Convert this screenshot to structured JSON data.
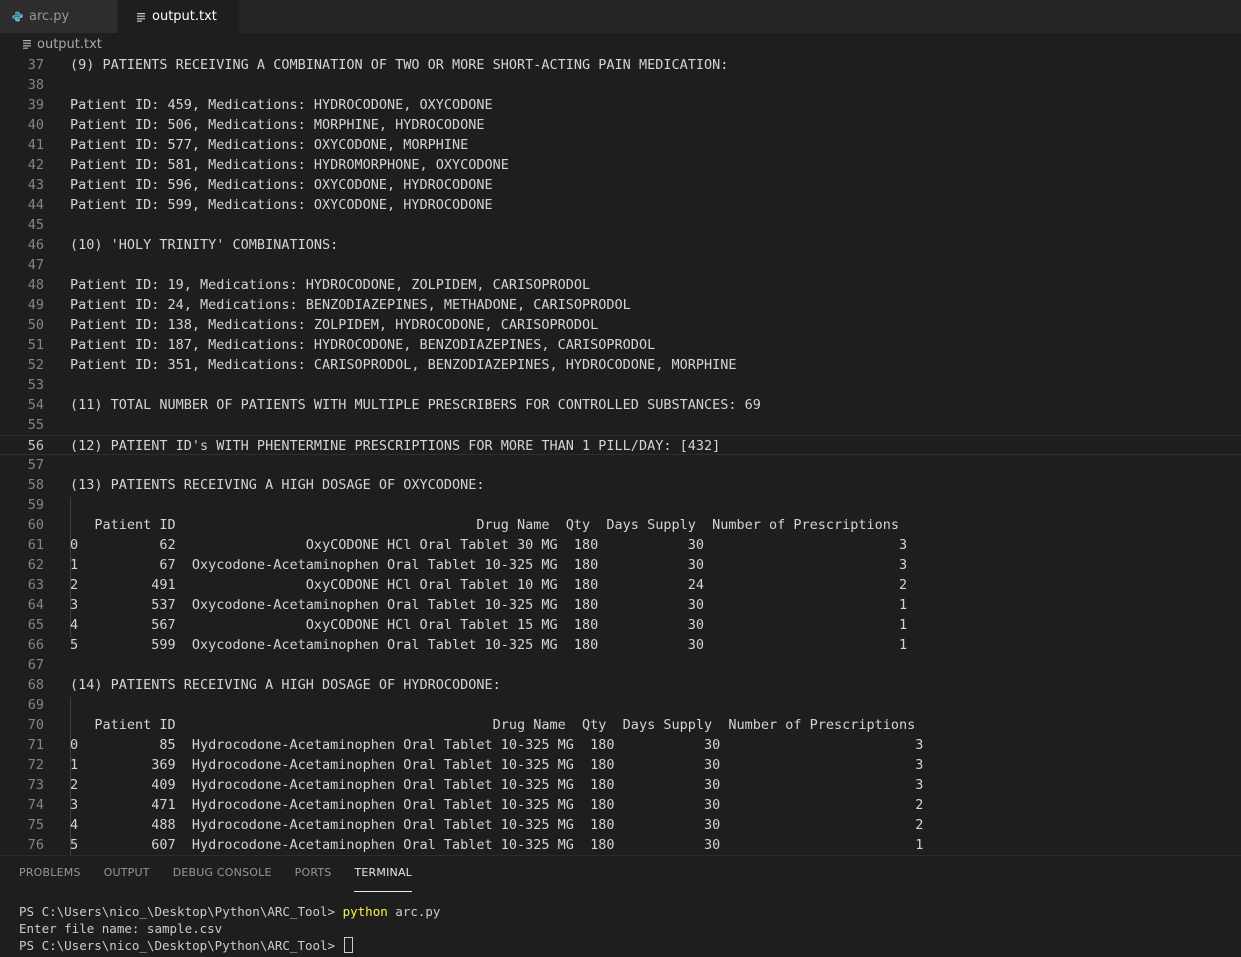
{
  "tabs": [
    {
      "label": "arc.py",
      "icon": "python-icon"
    },
    {
      "label": "output.txt",
      "icon": "text-file-icon"
    }
  ],
  "breadcrumb": {
    "label": "output.txt",
    "icon": "text-file-icon"
  },
  "editor": {
    "current_line": 56,
    "lines": [
      {
        "n": "37",
        "text": "(9) PATIENTS RECEIVING A COMBINATION OF TWO OR MORE SHORT-ACTING PAIN MEDICATION:"
      },
      {
        "n": "38",
        "text": ""
      },
      {
        "n": "39",
        "text": "Patient ID: 459, Medications: HYDROCODONE, OXYCODONE"
      },
      {
        "n": "40",
        "text": "Patient ID: 506, Medications: MORPHINE, HYDROCODONE"
      },
      {
        "n": "41",
        "text": "Patient ID: 577, Medications: OXYCODONE, MORPHINE"
      },
      {
        "n": "42",
        "text": "Patient ID: 581, Medications: HYDROMORPHONE, OXYCODONE"
      },
      {
        "n": "43",
        "text": "Patient ID: 596, Medications: OXYCODONE, HYDROCODONE"
      },
      {
        "n": "44",
        "text": "Patient ID: 599, Medications: OXYCODONE, HYDROCODONE"
      },
      {
        "n": "45",
        "text": ""
      },
      {
        "n": "46",
        "text": "(10) 'HOLY TRINITY' COMBINATIONS:"
      },
      {
        "n": "47",
        "text": ""
      },
      {
        "n": "48",
        "text": "Patient ID: 19, Medications: HYDROCODONE, ZOLPIDEM, CARISOPRODOL"
      },
      {
        "n": "49",
        "text": "Patient ID: 24, Medications: BENZODIAZEPINES, METHADONE, CARISOPRODOL"
      },
      {
        "n": "50",
        "text": "Patient ID: 138, Medications: ZOLPIDEM, HYDROCODONE, CARISOPRODOL"
      },
      {
        "n": "51",
        "text": "Patient ID: 187, Medications: HYDROCODONE, BENZODIAZEPINES, CARISOPRODOL"
      },
      {
        "n": "52",
        "text": "Patient ID: 351, Medications: CARISOPRODOL, BENZODIAZEPINES, HYDROCODONE, MORPHINE"
      },
      {
        "n": "53",
        "text": ""
      },
      {
        "n": "54",
        "text": "(11) TOTAL NUMBER OF PATIENTS WITH MULTIPLE PRESCRIBERS FOR CONTROLLED SUBSTANCES: 69"
      },
      {
        "n": "55",
        "text": ""
      },
      {
        "n": "56",
        "text": "(12) PATIENT ID's WITH PHENTERMINE PRESCRIPTIONS FOR MORE THAN 1 PILL/DAY: [432]"
      },
      {
        "n": "57",
        "text": ""
      },
      {
        "n": "58",
        "text": "(13) PATIENTS RECEIVING A HIGH DOSAGE OF OXYCODONE:"
      },
      {
        "n": "59",
        "text": ""
      },
      {
        "n": "60",
        "text": "   Patient ID                                     Drug Name  Qty  Days Supply  Number of Prescriptions"
      },
      {
        "n": "61",
        "text": "0          62                OxyCODONE HCl Oral Tablet 30 MG  180           30                        3"
      },
      {
        "n": "62",
        "text": "1          67  Oxycodone-Acetaminophen Oral Tablet 10-325 MG  180           30                        3"
      },
      {
        "n": "63",
        "text": "2         491                OxyCODONE HCl Oral Tablet 10 MG  180           24                        2"
      },
      {
        "n": "64",
        "text": "3         537  Oxycodone-Acetaminophen Oral Tablet 10-325 MG  180           30                        1"
      },
      {
        "n": "65",
        "text": "4         567                OxyCODONE HCl Oral Tablet 15 MG  180           30                        1"
      },
      {
        "n": "66",
        "text": "5         599  Oxycodone-Acetaminophen Oral Tablet 10-325 MG  180           30                        1"
      },
      {
        "n": "67",
        "text": ""
      },
      {
        "n": "68",
        "text": "(14) PATIENTS RECEIVING A HIGH DOSAGE OF HYDROCODONE:"
      },
      {
        "n": "69",
        "text": ""
      },
      {
        "n": "70",
        "text": "   Patient ID                                       Drug Name  Qty  Days Supply  Number of Prescriptions"
      },
      {
        "n": "71",
        "text": "0          85  Hydrocodone-Acetaminophen Oral Tablet 10-325 MG  180           30                        3"
      },
      {
        "n": "72",
        "text": "1         369  Hydrocodone-Acetaminophen Oral Tablet 10-325 MG  180           30                        3"
      },
      {
        "n": "73",
        "text": "2         409  Hydrocodone-Acetaminophen Oral Tablet 10-325 MG  180           30                        3"
      },
      {
        "n": "74",
        "text": "3         471  Hydrocodone-Acetaminophen Oral Tablet 10-325 MG  180           30                        2"
      },
      {
        "n": "75",
        "text": "4         488  Hydrocodone-Acetaminophen Oral Tablet 10-325 MG  180           30                        2"
      },
      {
        "n": "76",
        "text": "5         607  Hydrocodone-Acetaminophen Oral Tablet 10-325 MG  180           30                        1"
      }
    ]
  },
  "panel": {
    "tabs": [
      "PROBLEMS",
      "OUTPUT",
      "DEBUG CONSOLE",
      "PORTS",
      "TERMINAL"
    ],
    "active_tab": "TERMINAL"
  },
  "terminal": {
    "line1_prompt": "PS C:\\Users\\nico_\\Desktop\\Python\\ARC_Tool> ",
    "line1_cmd": "python",
    "line1_args": " arc.py",
    "line2": "Enter file name: sample.csv",
    "line3_prompt": "PS C:\\Users\\nico_\\Desktop\\Python\\ARC_Tool> "
  },
  "colors": {
    "editor_bg": "#1e1e1e",
    "tabbar_bg": "#252526",
    "terminal_command": "#f5f543",
    "python_icon": "#519aba"
  }
}
